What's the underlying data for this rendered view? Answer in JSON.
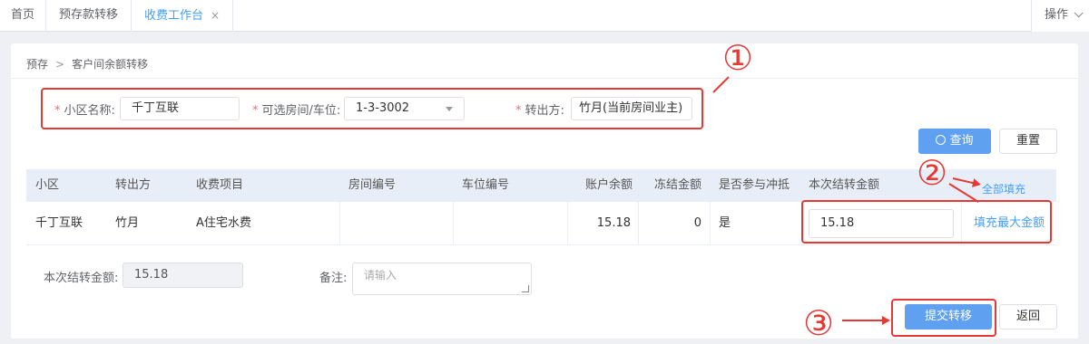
{
  "tabs": [
    {
      "label": "首页"
    },
    {
      "label": "预存款转移"
    },
    {
      "label": "收费工作台",
      "close": "×"
    }
  ],
  "ops_label": "操作",
  "breadcrumb": {
    "parent": "预存",
    "sep": ">",
    "current": "客户间余额转移"
  },
  "form": {
    "community_label": "小区名称:",
    "community_value": "千丁互联",
    "room_label": "可选房间/车位:",
    "room_value": "1-3-3002",
    "from_label": "转出方:",
    "from_value": "竹月(当前房间业主)"
  },
  "buttons": {
    "query": "查询",
    "reset": "重置",
    "submit": "提交转移",
    "back": "返回"
  },
  "table": {
    "fill_all": "全部填充",
    "headers": [
      "小区",
      "转出方",
      "收费项目",
      "房间编号",
      "车位编号",
      "账户余额",
      "冻结金额",
      "是否参与冲抵",
      "本次结转金额"
    ],
    "row": {
      "community": "千丁互联",
      "from": "竹月",
      "item": "A住宅水费",
      "room_no": "",
      "space_no": "",
      "balance": "15.18",
      "frozen": "0",
      "offset": "是",
      "amount": "15.18",
      "fill_max": "填充最大金额"
    }
  },
  "bottom": {
    "amount_label": "本次结转金额:",
    "amount_value": "15.18",
    "note_label": "备注:",
    "note_placeholder": "请输入"
  },
  "annotations": {
    "one": "①",
    "two": "②",
    "three": "③"
  },
  "colors": {
    "accent": "#409eff",
    "primary_button": "#5fa0f0",
    "annotation": "#e53935",
    "table_header": "#e7eef8"
  }
}
